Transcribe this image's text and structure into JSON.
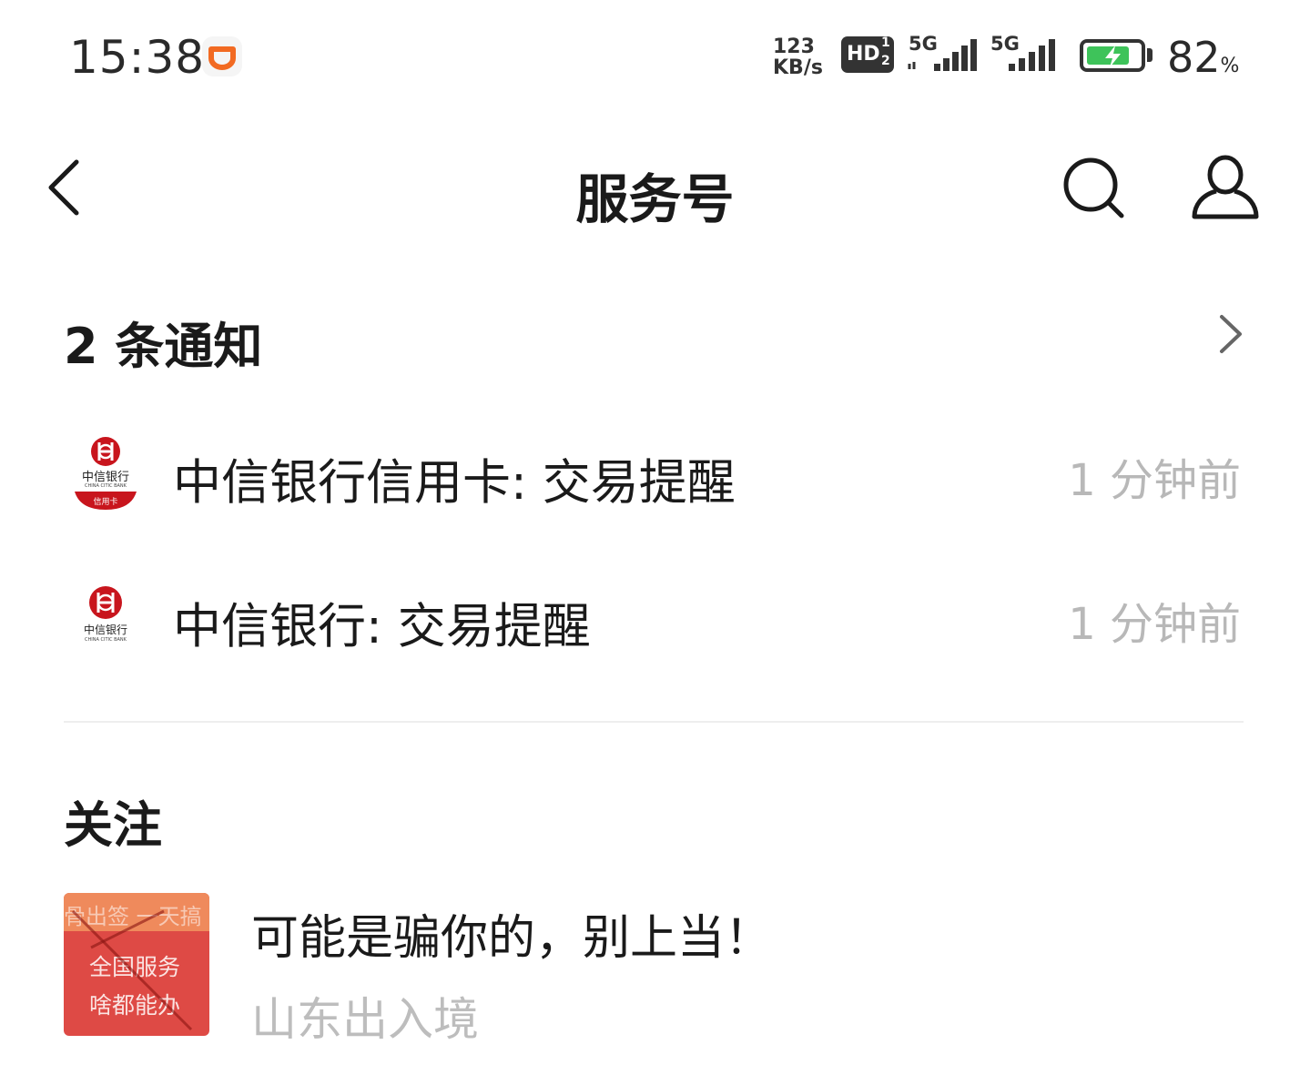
{
  "status_bar": {
    "time": "15:38",
    "net_speed_value": "123",
    "net_speed_unit": "KB/s",
    "hd_label": "HD",
    "hd_sub_top": "1",
    "hd_sub_bottom": "2",
    "sim1_label": "5G",
    "sim2_label": "5G",
    "battery_value": "82",
    "battery_unit": "%",
    "battery_level": 0.82,
    "battery_color": "#3ec35a"
  },
  "nav": {
    "title": "服务号",
    "back_icon": "chevron-left-icon",
    "search_icon": "search-icon",
    "profile_icon": "person-icon"
  },
  "notifications": {
    "header": "2 条通知",
    "items": [
      {
        "title": "中信银行信用卡: 交易提醒",
        "time": "1 分钟前",
        "logo_text": "中信银行",
        "logo_sub": "CHINA CITIC BANK",
        "logo_badge": "信用卡"
      },
      {
        "title": "中信银行: 交易提醒",
        "time": "1 分钟前",
        "logo_text": "中信银行",
        "logo_sub": "CHINA CITIC BANK"
      }
    ]
  },
  "follow": {
    "header": "关注",
    "item": {
      "thumb_line1": "骨出签 一天搞",
      "thumb_line2": "全国服务",
      "thumb_line3": "啥都能办",
      "title": "可能是骗你的，别上当！",
      "subtitle": "山东出入境"
    }
  },
  "colors": {
    "bank_red": "#c8151d",
    "app_icon_orange": "#f26a22",
    "thumb_red": "#de4a45"
  }
}
